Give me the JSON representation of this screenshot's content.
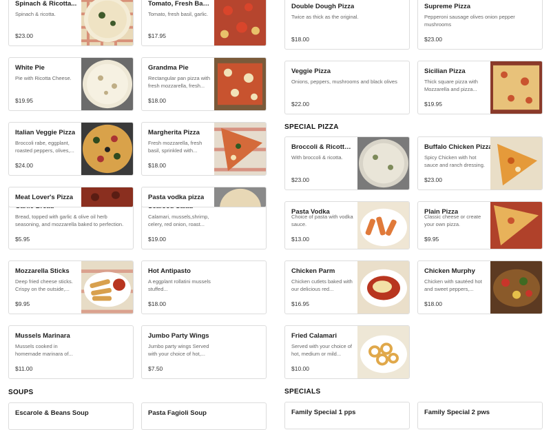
{
  "left_column": {
    "items": [
      {
        "name": "Spinach & Ricotta...",
        "desc": "Spinach & ricotta.",
        "price": "$23.00",
        "img": "white-spinach"
      },
      {
        "name": "Tomato, Fresh Basil,...",
        "desc": "Tomato, fresh basil, garlic.",
        "price": "$17.95",
        "img": "tomato-basil"
      },
      {
        "name": "White Pie",
        "desc": "Pie with Ricotta Cheese.",
        "price": "$19.95",
        "img": "white-pie"
      },
      {
        "name": "Grandma Pie",
        "desc": "Rectangular pan pizza with fresh mozzarella, fresh...",
        "price": "$18.00",
        "img": "grandma"
      },
      {
        "name": "Italian Veggie Pizza",
        "desc": "Broccoli rabe, eggplant, roasted peppers, olives,...",
        "price": "$24.00",
        "img": "veggie"
      },
      {
        "name": "Margherita Pizza",
        "desc": "Fresh mozzarella, fresh basil, sprinkled with...",
        "price": "$18.00",
        "img": "margherita"
      },
      {
        "name": "Meat Lover's Pizza",
        "desc": "",
        "price": "",
        "img": "meat"
      },
      {
        "name": "Pasta vodka pizza",
        "desc": "",
        "price": "",
        "img": "vodka-pizza"
      },
      {
        "name": "Garlic Bread",
        "desc": "Bread, topped with garlic & olive oil herb seasoning, and mozzarella baked to perfection.",
        "price": "$5.95",
        "img": ""
      },
      {
        "name": "Seafood Salad",
        "desc": "Calamari, mussels,shrimp, celery, red onion, roast...",
        "price": "$19.00",
        "img": ""
      },
      {
        "name": "Mozzarella Sticks",
        "desc": "Deep fried cheese sticks. Crispy on the outside,...",
        "price": "$9.95",
        "img": "sticks"
      },
      {
        "name": "Hot Antipasto",
        "desc": "A eggplant rollatini mussels stuffed...",
        "price": "$18.00",
        "img": ""
      },
      {
        "name": "Mussels Marinara",
        "desc": "Mussels cooked in homemade marinara of...",
        "price": "$11.00",
        "img": ""
      },
      {
        "name": "Jumbo Party Wings",
        "desc": "Jumbo party wings Served with your choice of hot,...",
        "price": "$7.50",
        "img": ""
      }
    ],
    "section_soups": "SOUPS",
    "soups": [
      {
        "name": "Escarole & Beans Soup"
      },
      {
        "name": "Pasta Fagioli Soup"
      }
    ]
  },
  "right_column": {
    "items": [
      {
        "name": "Double Dough Pizza",
        "desc": "Twice as thick as the original.",
        "price": "$18.00",
        "img": ""
      },
      {
        "name": "Supreme Pizza",
        "desc": "Pepperoni sausage olives onion pepper mushrooms",
        "price": "$23.00",
        "img": ""
      },
      {
        "name": "Veggie Pizza",
        "desc": "Onions, peppers, mushrooms and black olives",
        "price": "$22.00",
        "img": ""
      },
      {
        "name": "Sicilian Pizza",
        "desc": "Thick square pizza with Mozzarella and pizza...",
        "price": "$19.95",
        "img": "sicilian"
      }
    ],
    "section_special": "SPECIAL PIZZA",
    "special": [
      {
        "name": "Broccoli & Ricotta...",
        "desc": "With broccoli & ricotta.",
        "price": "$23.00",
        "img": "broccoli"
      },
      {
        "name": "Buffalo Chicken Pizza",
        "desc": "Spicy Chicken with hot sauce and ranch dressing.",
        "price": "$23.00",
        "img": "buffalo"
      },
      {
        "name": "Pasta Vodka",
        "desc": "Choice of pasta with vodka sauce.",
        "price": "$13.00",
        "img": "penne"
      },
      {
        "name": "Plain Pizza",
        "desc": "Classic cheese or create your own pizza.",
        "price": "$9.95",
        "img": "plain"
      },
      {
        "name": "Chicken Parm",
        "desc": "Chicken cutlets baked with our delicious red...",
        "price": "$16.95",
        "img": "parm"
      },
      {
        "name": "Chicken Murphy",
        "desc": "Chicken with sautéed hot and sweet peppers,...",
        "price": "$18.00",
        "img": "murphy"
      },
      {
        "name": "Fried Calamari",
        "desc": "Served with your choice of hot, medium or mild...",
        "price": "$10.00",
        "img": "calamari"
      }
    ],
    "section_specials": "SPECIALS",
    "specials": [
      {
        "name": "Family Special 1 pps"
      },
      {
        "name": "Family Special 2 pws"
      }
    ]
  },
  "colors": {
    "accent": "#111111",
    "border": "#dcdcdc",
    "muted": "#666666"
  }
}
